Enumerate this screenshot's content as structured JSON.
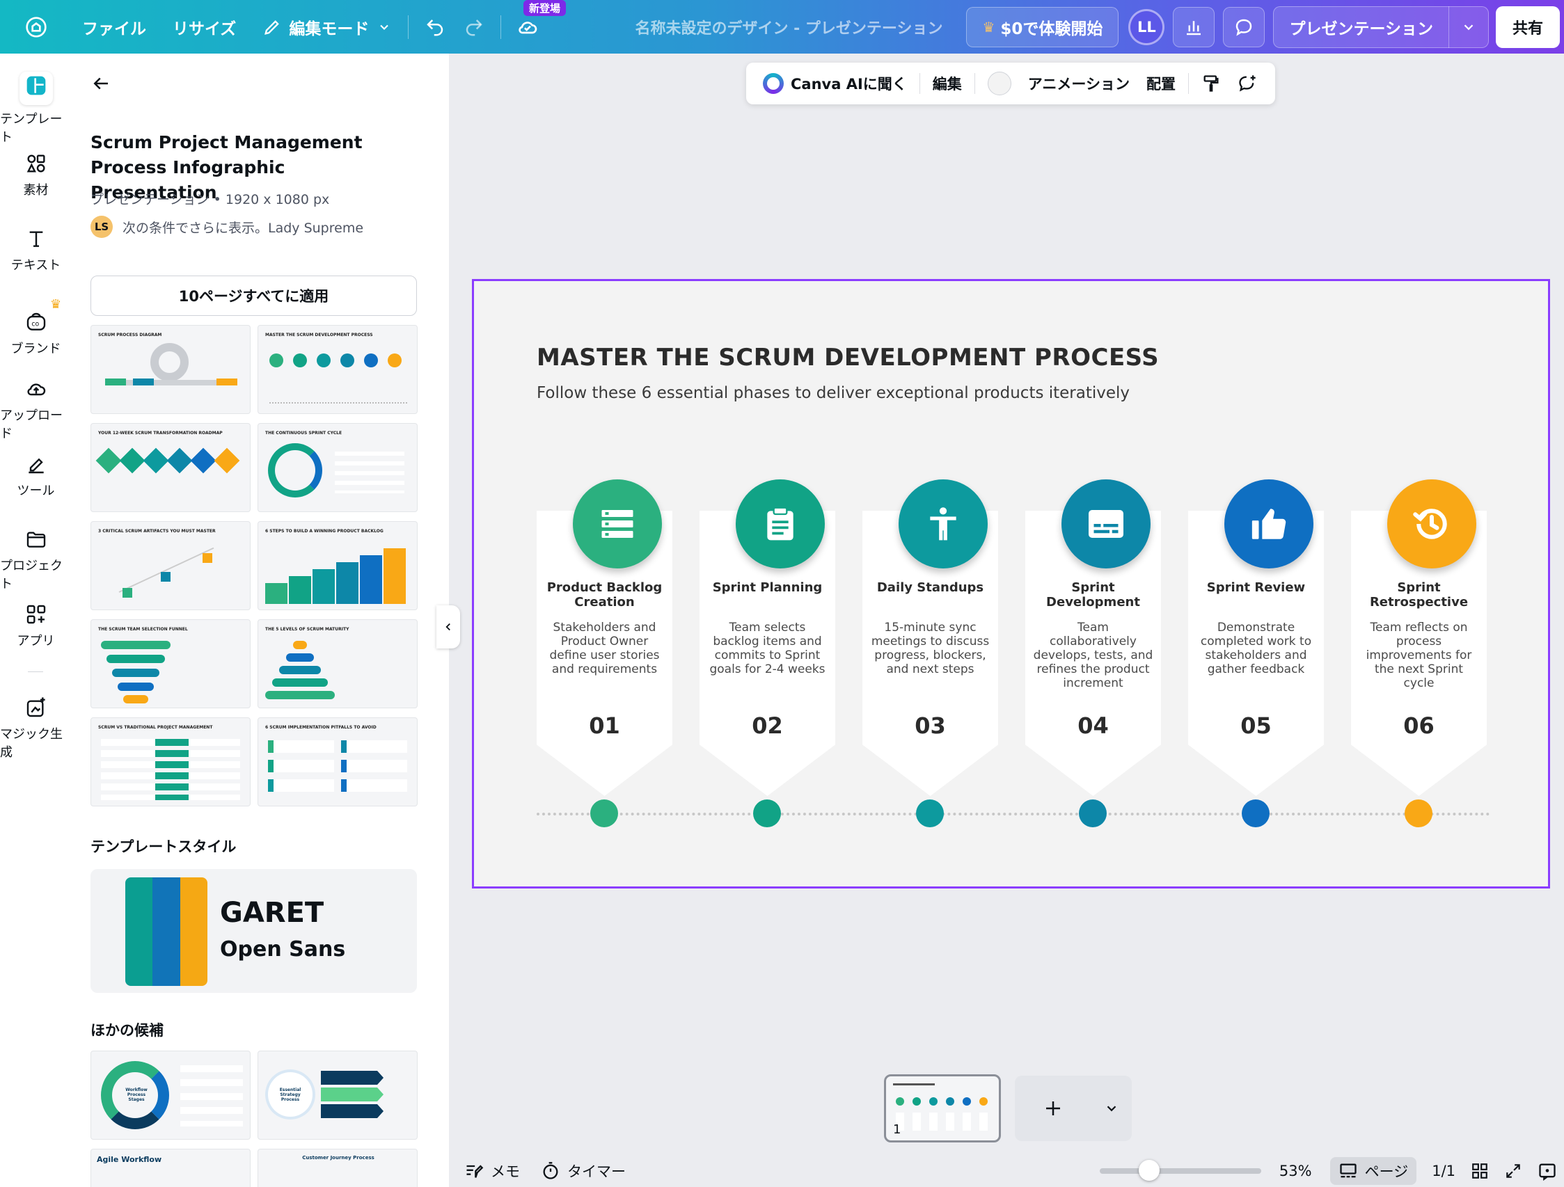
{
  "topbar": {
    "file_label": "ファイル",
    "resize_label": "リサイズ",
    "edit_mode_label": "編集モード",
    "new_badge": "新登場",
    "doc_title": "名称未設定のデザイン - プレゼンテーション",
    "trial_label": "$0で体験開始",
    "avatar_initials": "LL",
    "present_label": "プレゼンテーション",
    "share_label": "共有"
  },
  "rail": {
    "items": [
      {
        "label": "テンプレート",
        "icon": "template-icon"
      },
      {
        "label": "素材",
        "icon": "elements-icon"
      },
      {
        "label": "テキスト",
        "icon": "text-icon"
      },
      {
        "label": "ブランド",
        "icon": "brand-icon"
      },
      {
        "label": "アップロード",
        "icon": "upload-icon"
      },
      {
        "label": "ツール",
        "icon": "tools-icon"
      },
      {
        "label": "プロジェクト",
        "icon": "folder-icon"
      },
      {
        "label": "アプリ",
        "icon": "apps-icon"
      },
      {
        "label": "マジック生成",
        "icon": "magic-icon"
      }
    ]
  },
  "panel": {
    "title": "Scrum Project Management Process Infographic Presentation",
    "meta": "プレゼンテーション • 1920 x 1080 px",
    "author_initials": "LS",
    "author_text": "次の条件でさらに表示。Lady Supreme",
    "apply_label": "10ページすべてに適用",
    "thumbnails": [
      "SCRUM PROCESS DIAGRAM",
      "MASTER THE SCRUM DEVELOPMENT PROCESS",
      "YOUR 12-WEEK SCRUM TRANSFORMATION ROADMAP",
      "THE CONTINUOUS SPRINT CYCLE",
      "3 CRITICAL SCRUM ARTIFACTS YOU MUST MASTER",
      "6 STEPS TO BUILD A WINNING PRODUCT BACKLOG",
      "THE SCRUM TEAM SELECTION FUNNEL",
      "THE 5 LEVELS OF SCRUM MATURITY",
      "SCRUM VS TRADITIONAL PROJECT MANAGEMENT",
      "6 SCRUM IMPLEMENTATION PITFALLS TO AVOID"
    ],
    "style_heading": "テンプレートスタイル",
    "style_font_heading": "GARET",
    "style_font_body": "Open Sans",
    "style_colors": [
      "#0b9e91",
      "#1174b8",
      "#f5a814"
    ],
    "other_heading": "ほかの候補",
    "other_thumbs": [
      "Workflow Process Stages",
      "Essential Strategy Process",
      "Agile Workflow",
      "Customer Journey Process"
    ]
  },
  "context_toolbar": {
    "ask_ai": "Canva AIに聞く",
    "edit": "編集",
    "animation": "アニメーション",
    "position": "配置"
  },
  "slide": {
    "title": "MASTER THE SCRUM DEVELOPMENT PROCESS",
    "subtitle": "Follow these 6 essential phases to deliver exceptional products iteratively",
    "phases": [
      {
        "title": "Product Backlog Creation",
        "desc": "Stakeholders and Product Owner define user stories and requirements",
        "num": "01",
        "color": "#2bb07f",
        "icon": "list-icon"
      },
      {
        "title": "Sprint Planning",
        "desc": "Team selects backlog items and commits to Sprint goals for 2-4 weeks",
        "num": "02",
        "color": "#11a386",
        "icon": "clipboard-icon"
      },
      {
        "title": "Daily Standups",
        "desc": "15-minute sync meetings to discuss progress, blockers, and next steps",
        "num": "03",
        "color": "#0d9a9e",
        "icon": "person-icon"
      },
      {
        "title": "Sprint Development",
        "desc": "Team collaboratively develops, tests, and refines the product increment",
        "num": "04",
        "color": "#0d87a8",
        "icon": "subtitles-icon"
      },
      {
        "title": "Sprint Review",
        "desc": "Demonstrate completed work to stakeholders and gather feedback",
        "num": "05",
        "color": "#0f6fc2",
        "icon": "thumbs-up-icon"
      },
      {
        "title": "Sprint Retrospective",
        "desc": "Team reflects on process improvements for the next Sprint cycle",
        "num": "06",
        "color": "#f9a816",
        "icon": "history-icon"
      }
    ]
  },
  "pages": {
    "current_page_number": "1"
  },
  "bottombar": {
    "notes_label": "メモ",
    "timer_label": "タイマー",
    "zoom_label": "53%",
    "zoom_value": 53,
    "pages_label": "ページ",
    "page_count": "1/1"
  }
}
